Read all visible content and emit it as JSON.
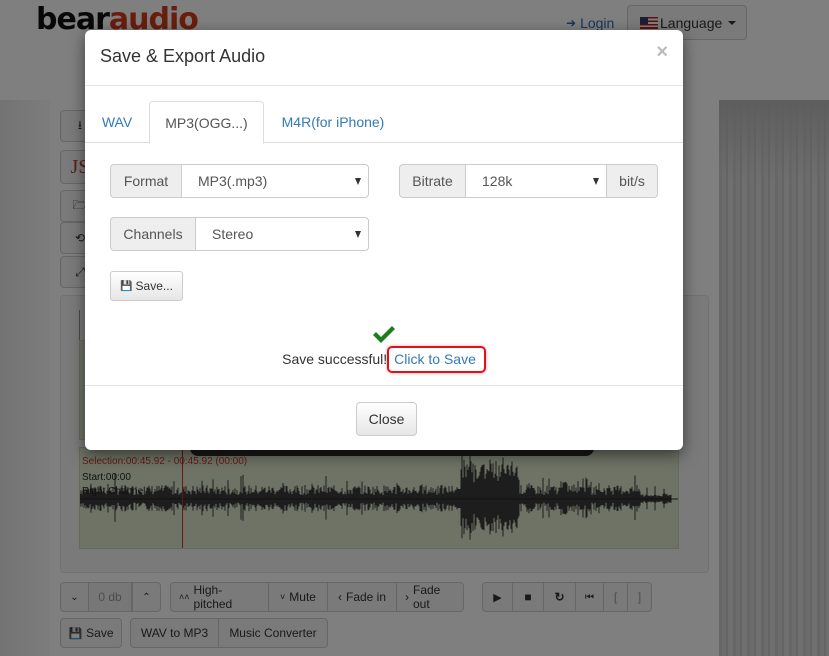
{
  "header": {
    "logo": {
      "part1": "bear",
      "part2": "audio"
    },
    "login_label": "Login",
    "language_label": "Language"
  },
  "sidebar_buttons": [
    {
      "icon": "download-icon"
    },
    {
      "icon": "js-icon",
      "label": "JS"
    },
    {
      "icon": "folder-open-icon"
    },
    {
      "icon": "history-icon"
    },
    {
      "icon": "fullscreen-icon"
    }
  ],
  "waveform": {
    "selection_text": "Selection:00:45.92 - 00:45.92 (00:00)",
    "start_text": "Start:00:00",
    "channel_label": "Right Channel"
  },
  "toolbar": {
    "volume_down_label": "⌄",
    "db_value": "0 db",
    "volume_up_label": "⌃",
    "effects": [
      {
        "icon": "»",
        "label": "High-pitched"
      },
      {
        "icon": "»",
        "label": "Mute"
      },
      {
        "icon": "‹",
        "label": "Fade in"
      },
      {
        "icon": "›",
        "label": "Fade out"
      }
    ],
    "playback": [
      {
        "name": "play-button",
        "glyph": "▶"
      },
      {
        "name": "stop-button",
        "glyph": "■"
      },
      {
        "name": "repeat-button",
        "glyph": "↻"
      },
      {
        "name": "skip-start-button",
        "glyph": "⏮"
      },
      {
        "name": "mark-in-button",
        "glyph": "["
      },
      {
        "name": "mark-out-button",
        "glyph": "]"
      }
    ],
    "save_label": "Save",
    "wav_to_mp3_label": "WAV to MP3",
    "music_converter_label": "Music Converter"
  },
  "modal": {
    "title": "Save & Export Audio",
    "close_glyph": "×",
    "tabs": [
      {
        "label": "WAV",
        "active": false
      },
      {
        "label": "MP3(OGG...)",
        "active": true
      },
      {
        "label": "M4R(for iPhone)",
        "active": false
      }
    ],
    "format": {
      "label": "Format",
      "value": "MP3(.mp3)"
    },
    "bitrate": {
      "label": "Bitrate",
      "value": "128k",
      "unit": "bit/s"
    },
    "channels": {
      "label": "Channels",
      "value": "Stereo"
    },
    "save_button_label": "Save...",
    "status_text": "Save successful!",
    "click_to_save_label": "Click to Save",
    "close_button_label": "Close",
    "success_color": "#1e7e1e",
    "highlight_color": "#e0101a",
    "link_color": "#337ab7"
  }
}
